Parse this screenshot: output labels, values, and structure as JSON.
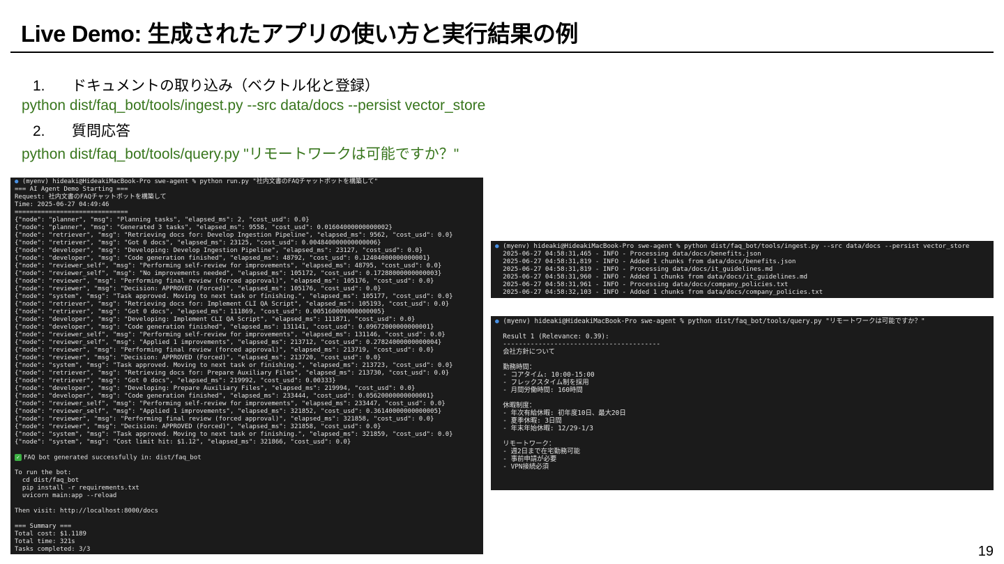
{
  "slide": {
    "title": "Live Demo: 生成されたアプリの使い方と実行結果の例",
    "page_number": "19"
  },
  "steps": [
    {
      "number": "1.",
      "label": "ドキュメントの取り込み（ベクトル化と登録）",
      "command": "python dist/faq_bot/tools/ingest.py --src data/docs --persist vector_store"
    },
    {
      "number": "2.",
      "label": "質問応答",
      "command": "python dist/faq_bot/tools/query.py \"リモートワークは可能ですか？\""
    }
  ],
  "terminal_main": {
    "prompt": "(myenv) hideaki@HideakiMacBook-Pro swe-agent % python run.py \"社内文書のFAQチャットボットを構築して\"",
    "lines": [
      "=== AI Agent Demo Starting ===",
      "Request: 社内文書のFAQチャットボットを構築して",
      "Time: 2025-06-27 04:49:46",
      "==============================",
      "{\"node\": \"planner\", \"msg\": \"Planning tasks\", \"elapsed_ms\": 2, \"cost_usd\": 0.0}",
      "{\"node\": \"planner\", \"msg\": \"Generated 3 tasks\", \"elapsed_ms\": 9558, \"cost_usd\": 0.01604000000000002}",
      "{\"node\": \"retriever\", \"msg\": \"Retrieving docs for: Develop Ingestion Pipeline\", \"elapsed_ms\": 9562, \"cost_usd\": 0.0}",
      "{\"node\": \"retriever\", \"msg\": \"Got 0 docs\", \"elapsed_ms\": 23125, \"cost_usd\": 0.004840000000000006}",
      "{\"node\": \"developer\", \"msg\": \"Developing: Develop Ingestion Pipeline\", \"elapsed_ms\": 23127, \"cost_usd\": 0.0}",
      "{\"node\": \"developer\", \"msg\": \"Code generation finished\", \"elapsed_ms\": 48792, \"cost_usd\": 0.12404000000000001}",
      "{\"node\": \"reviewer_self\", \"msg\": \"Performing self-review for improvements\", \"elapsed_ms\": 48795, \"cost_usd\": 0.0}",
      "{\"node\": \"reviewer_self\", \"msg\": \"No improvements needed\", \"elapsed_ms\": 105172, \"cost_usd\": 0.17288000000000003}",
      "{\"node\": \"reviewer\", \"msg\": \"Performing final review (forced approval)\", \"elapsed_ms\": 105176, \"cost_usd\": 0.0}",
      "{\"node\": \"reviewer\", \"msg\": \"Decision: APPROVED (Forced)\", \"elapsed_ms\": 105176, \"cost_usd\": 0.0}",
      "{\"node\": \"system\", \"msg\": \"Task approved. Moving to next task or finishing.\", \"elapsed_ms\": 105177, \"cost_usd\": 0.0}",
      "{\"node\": \"retriever\", \"msg\": \"Retrieving docs for: Implement CLI QA Script\", \"elapsed_ms\": 105193, \"cost_usd\": 0.0}",
      "{\"node\": \"retriever\", \"msg\": \"Got 0 docs\", \"elapsed_ms\": 111869, \"cost_usd\": 0.005160000000000005}",
      "{\"node\": \"developer\", \"msg\": \"Developing: Implement CLI QA Script\", \"elapsed_ms\": 111871, \"cost_usd\": 0.0}",
      "{\"node\": \"developer\", \"msg\": \"Code generation finished\", \"elapsed_ms\": 131141, \"cost_usd\": 0.09672000000000001}",
      "{\"node\": \"reviewer_self\", \"msg\": \"Performing self-review for improvements\", \"elapsed_ms\": 131146, \"cost_usd\": 0.0}",
      "{\"node\": \"reviewer_self\", \"msg\": \"Applied 1 improvements\", \"elapsed_ms\": 213712, \"cost_usd\": 0.27824000000000004}",
      "{\"node\": \"reviewer\", \"msg\": \"Performing final review (forced approval)\", \"elapsed_ms\": 213719, \"cost_usd\": 0.0}",
      "{\"node\": \"reviewer\", \"msg\": \"Decision: APPROVED (Forced)\", \"elapsed_ms\": 213720, \"cost_usd\": 0.0}",
      "{\"node\": \"system\", \"msg\": \"Task approved. Moving to next task or finishing.\", \"elapsed_ms\": 213723, \"cost_usd\": 0.0}",
      "{\"node\": \"retriever\", \"msg\": \"Retrieving docs for: Prepare Auxiliary Files\", \"elapsed_ms\": 213730, \"cost_usd\": 0.0}",
      "{\"node\": \"retriever\", \"msg\": \"Got 0 docs\", \"elapsed_ms\": 219992, \"cost_usd\": 0.00333}",
      "{\"node\": \"developer\", \"msg\": \"Developing: Prepare Auxiliary Files\", \"elapsed_ms\": 219994, \"cost_usd\": 0.0}",
      "{\"node\": \"developer\", \"msg\": \"Code generation finished\", \"elapsed_ms\": 233444, \"cost_usd\": 0.05620000000000001}",
      "{\"node\": \"reviewer_self\", \"msg\": \"Performing self-review for improvements\", \"elapsed_ms\": 233447, \"cost_usd\": 0.0}",
      "{\"node\": \"reviewer_self\", \"msg\": \"Applied 1 improvements\", \"elapsed_ms\": 321852, \"cost_usd\": 0.36140000000000005}",
      "{\"node\": \"reviewer\", \"msg\": \"Performing final review (forced approval)\", \"elapsed_ms\": 321858, \"cost_usd\": 0.0}",
      "{\"node\": \"reviewer\", \"msg\": \"Decision: APPROVED (Forced)\", \"elapsed_ms\": 321858, \"cost_usd\": 0.0}",
      "{\"node\": \"system\", \"msg\": \"Task approved. Moving to next task or finishing.\", \"elapsed_ms\": 321859, \"cost_usd\": 0.0}",
      "{\"node\": \"system\", \"msg\": \"Cost limit hit: $1.12\", \"elapsed_ms\": 321866, \"cost_usd\": 0.0}",
      "",
      "FAQ bot generated successfully in: dist/faq_bot",
      "",
      "To run the bot:",
      "  cd dist/faq_bot",
      "  pip install -r requirements.txt",
      "  uvicorn main:app --reload",
      "",
      "Then visit: http://localhost:8000/docs",
      "",
      "=== Summary ===",
      "Total cost: $1.1189",
      "Total time: 321s",
      "Tasks completed: 3/3"
    ],
    "success_icon": "check-icon"
  },
  "terminal_ingest": {
    "prompt": "(myenv) hideaki@HideakiMacBook-Pro swe-agent % python dist/faq_bot/tools/ingest.py --src data/docs --persist vector_store",
    "lines": [
      "  2025-06-27 04:58:31,465 - INFO - Processing data/docs/benefits.json",
      "  2025-06-27 04:58:31,819 - INFO - Added 1 chunks from data/docs/benefits.json",
      "  2025-06-27 04:58:31,819 - INFO - Processing data/docs/it_guidelines.md",
      "  2025-06-27 04:58:31,960 - INFO - Added 1 chunks from data/docs/it_guidelines.md",
      "  2025-06-27 04:58:31,961 - INFO - Processing data/docs/company_policies.txt",
      "  2025-06-27 04:58:32,103 - INFO - Added 1 chunks from data/docs/company_policies.txt"
    ]
  },
  "terminal_query": {
    "prompt": "(myenv) hideaki@HideakiMacBook-Pro swe-agent % python dist/faq_bot/tools/query.py \"リモートワークは可能ですか？\"",
    "lines": [
      "",
      "  Result 1 (Relevance: 0.39):",
      "  ----------------------------------------",
      "  会社方針について",
      "",
      "  勤務時間：",
      "  - コアタイム: 10:00-15:00",
      "  - フレックスタイム制を採用",
      "  - 月間労働時間: 160時間",
      "",
      "  休暇制度：",
      "  - 年次有給休暇: 初年度10日、最大20日",
      "  - 夏季休暇: 3日間",
      "  - 年末年始休暇: 12/29-1/3",
      "",
      "  リモートワーク：",
      "  - 週2日まで在宅勤務可能",
      "  - 事前申請が必要",
      "  - VPN接続必須"
    ]
  },
  "colors": {
    "command_green": "#38761d",
    "terminal_bg": "#1b1b1b",
    "prompt_dot": "#4a90e2",
    "check_green": "#3cb043"
  }
}
